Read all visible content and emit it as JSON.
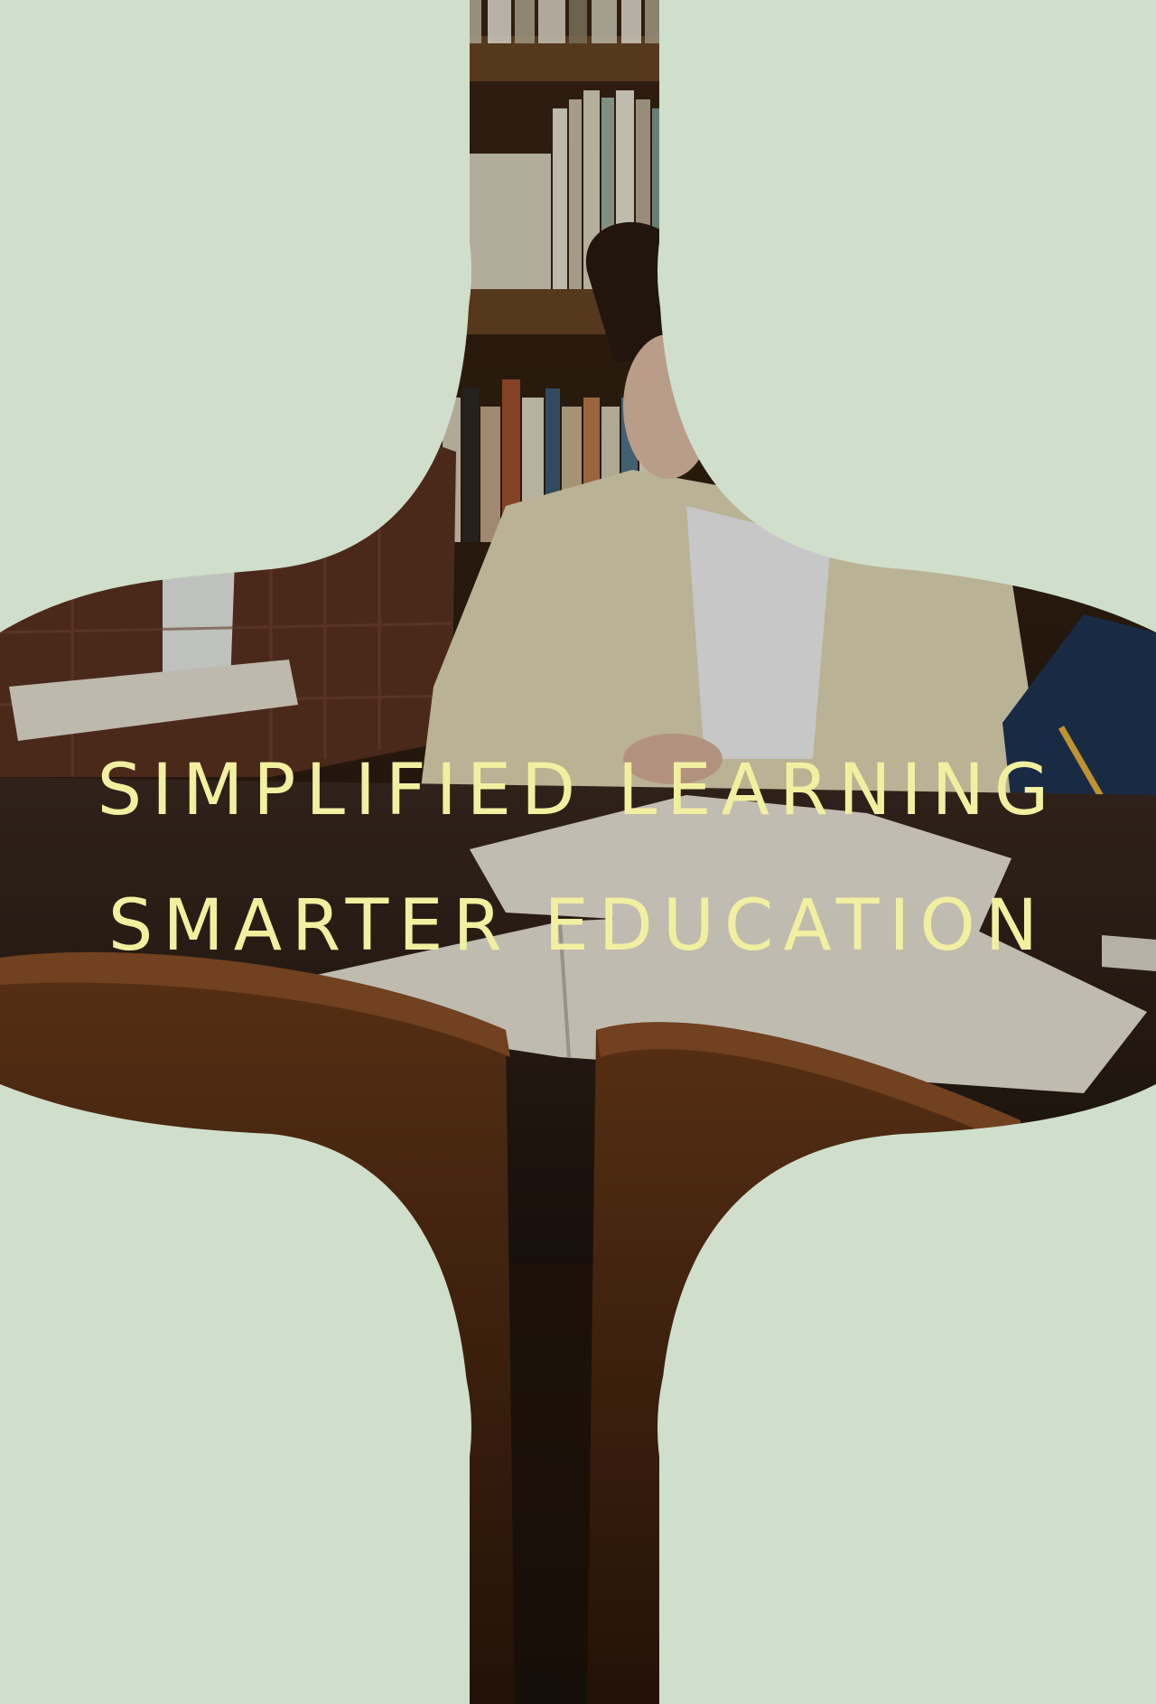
{
  "poster": {
    "headline_line1": "SIMPLIFIED LEARNING",
    "headline_line2": "SMARTER EDUCATION",
    "photo_subject": "students reading books at a library table",
    "colors": {
      "background_sage": "#cfdfcb",
      "headline_yellow": "#f1f0a0",
      "wood_dark": "#2a1a10",
      "shelf_brown": "#5a3a1e"
    },
    "icons": [
      "decorative-circle-shape"
    ]
  }
}
